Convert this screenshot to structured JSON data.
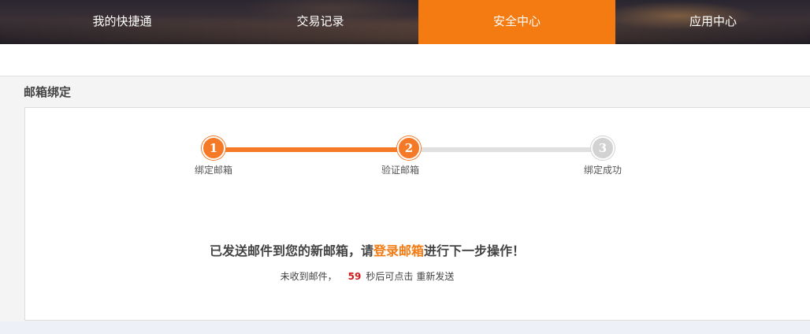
{
  "nav": {
    "items": [
      {
        "label": "我的快捷通",
        "active": false
      },
      {
        "label": "交易记录",
        "active": false
      },
      {
        "label": "安全中心",
        "active": true
      },
      {
        "label": "应用中心",
        "active": false
      }
    ],
    "active_color": "#f47a12"
  },
  "page": {
    "title": "邮箱绑定"
  },
  "steps": [
    {
      "number": "1",
      "label": "绑定邮箱",
      "status": "done"
    },
    {
      "number": "2",
      "label": "验证邮箱",
      "status": "current"
    },
    {
      "number": "3",
      "label": "绑定成功",
      "status": "pending"
    }
  ],
  "message": {
    "prefix": "已发送邮件到您的新邮箱，请",
    "link": "登录邮箱",
    "suffix": "进行下一步操作！"
  },
  "resend": {
    "prefix": "未收到邮件，",
    "seconds": "59",
    "middle": "秒后可点击",
    "link": "重新发送"
  },
  "colors": {
    "accent": "#f47a28",
    "countdown": "#d41b1b",
    "pending": "#d2d2d2"
  }
}
